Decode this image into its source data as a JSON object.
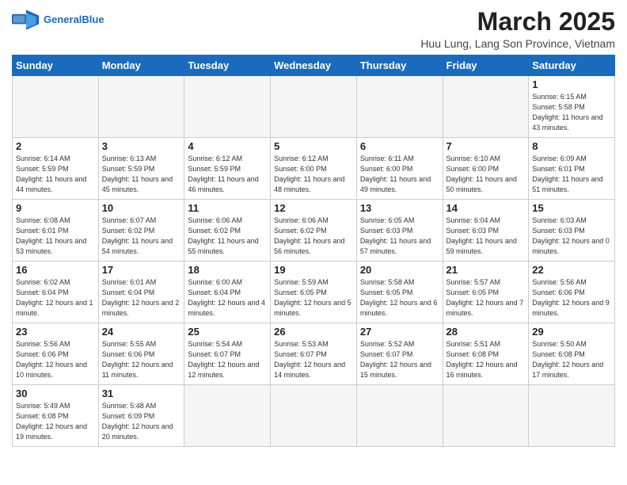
{
  "header": {
    "logo_general": "General",
    "logo_blue": "Blue",
    "month_title": "March 2025",
    "location": "Huu Lung, Lang Son Province, Vietnam"
  },
  "days_of_week": [
    "Sunday",
    "Monday",
    "Tuesday",
    "Wednesday",
    "Thursday",
    "Friday",
    "Saturday"
  ],
  "weeks": [
    [
      {
        "day": "",
        "empty": true
      },
      {
        "day": "",
        "empty": true
      },
      {
        "day": "",
        "empty": true
      },
      {
        "day": "",
        "empty": true
      },
      {
        "day": "",
        "empty": true
      },
      {
        "day": "",
        "empty": true
      },
      {
        "day": "1",
        "sunrise": "6:15 AM",
        "sunset": "5:58 PM",
        "daylight": "11 hours and 43 minutes."
      }
    ],
    [
      {
        "day": "2",
        "sunrise": "6:14 AM",
        "sunset": "5:59 PM",
        "daylight": "11 hours and 44 minutes."
      },
      {
        "day": "3",
        "sunrise": "6:13 AM",
        "sunset": "5:59 PM",
        "daylight": "11 hours and 45 minutes."
      },
      {
        "day": "4",
        "sunrise": "6:12 AM",
        "sunset": "5:59 PM",
        "daylight": "11 hours and 46 minutes."
      },
      {
        "day": "5",
        "sunrise": "6:12 AM",
        "sunset": "6:00 PM",
        "daylight": "11 hours and 48 minutes."
      },
      {
        "day": "6",
        "sunrise": "6:11 AM",
        "sunset": "6:00 PM",
        "daylight": "11 hours and 49 minutes."
      },
      {
        "day": "7",
        "sunrise": "6:10 AM",
        "sunset": "6:00 PM",
        "daylight": "11 hours and 50 minutes."
      },
      {
        "day": "8",
        "sunrise": "6:09 AM",
        "sunset": "6:01 PM",
        "daylight": "11 hours and 51 minutes."
      }
    ],
    [
      {
        "day": "9",
        "sunrise": "6:08 AM",
        "sunset": "6:01 PM",
        "daylight": "11 hours and 53 minutes."
      },
      {
        "day": "10",
        "sunrise": "6:07 AM",
        "sunset": "6:02 PM",
        "daylight": "11 hours and 54 minutes."
      },
      {
        "day": "11",
        "sunrise": "6:06 AM",
        "sunset": "6:02 PM",
        "daylight": "11 hours and 55 minutes."
      },
      {
        "day": "12",
        "sunrise": "6:06 AM",
        "sunset": "6:02 PM",
        "daylight": "11 hours and 56 minutes."
      },
      {
        "day": "13",
        "sunrise": "6:05 AM",
        "sunset": "6:03 PM",
        "daylight": "11 hours and 57 minutes."
      },
      {
        "day": "14",
        "sunrise": "6:04 AM",
        "sunset": "6:03 PM",
        "daylight": "11 hours and 59 minutes."
      },
      {
        "day": "15",
        "sunrise": "6:03 AM",
        "sunset": "6:03 PM",
        "daylight": "12 hours and 0 minutes."
      }
    ],
    [
      {
        "day": "16",
        "sunrise": "6:02 AM",
        "sunset": "6:04 PM",
        "daylight": "12 hours and 1 minute."
      },
      {
        "day": "17",
        "sunrise": "6:01 AM",
        "sunset": "6:04 PM",
        "daylight": "12 hours and 2 minutes."
      },
      {
        "day": "18",
        "sunrise": "6:00 AM",
        "sunset": "6:04 PM",
        "daylight": "12 hours and 4 minutes."
      },
      {
        "day": "19",
        "sunrise": "5:59 AM",
        "sunset": "6:05 PM",
        "daylight": "12 hours and 5 minutes."
      },
      {
        "day": "20",
        "sunrise": "5:58 AM",
        "sunset": "6:05 PM",
        "daylight": "12 hours and 6 minutes."
      },
      {
        "day": "21",
        "sunrise": "5:57 AM",
        "sunset": "6:05 PM",
        "daylight": "12 hours and 7 minutes."
      },
      {
        "day": "22",
        "sunrise": "5:56 AM",
        "sunset": "6:06 PM",
        "daylight": "12 hours and 9 minutes."
      }
    ],
    [
      {
        "day": "23",
        "sunrise": "5:56 AM",
        "sunset": "6:06 PM",
        "daylight": "12 hours and 10 minutes."
      },
      {
        "day": "24",
        "sunrise": "5:55 AM",
        "sunset": "6:06 PM",
        "daylight": "12 hours and 11 minutes."
      },
      {
        "day": "25",
        "sunrise": "5:54 AM",
        "sunset": "6:07 PM",
        "daylight": "12 hours and 12 minutes."
      },
      {
        "day": "26",
        "sunrise": "5:53 AM",
        "sunset": "6:07 PM",
        "daylight": "12 hours and 14 minutes."
      },
      {
        "day": "27",
        "sunrise": "5:52 AM",
        "sunset": "6:07 PM",
        "daylight": "12 hours and 15 minutes."
      },
      {
        "day": "28",
        "sunrise": "5:51 AM",
        "sunset": "6:08 PM",
        "daylight": "12 hours and 16 minutes."
      },
      {
        "day": "29",
        "sunrise": "5:50 AM",
        "sunset": "6:08 PM",
        "daylight": "12 hours and 17 minutes."
      }
    ],
    [
      {
        "day": "30",
        "sunrise": "5:49 AM",
        "sunset": "6:08 PM",
        "daylight": "12 hours and 19 minutes."
      },
      {
        "day": "31",
        "sunrise": "5:48 AM",
        "sunset": "6:09 PM",
        "daylight": "12 hours and 20 minutes."
      },
      {
        "day": "",
        "empty": true
      },
      {
        "day": "",
        "empty": true
      },
      {
        "day": "",
        "empty": true
      },
      {
        "day": "",
        "empty": true
      },
      {
        "day": "",
        "empty": true
      }
    ]
  ]
}
